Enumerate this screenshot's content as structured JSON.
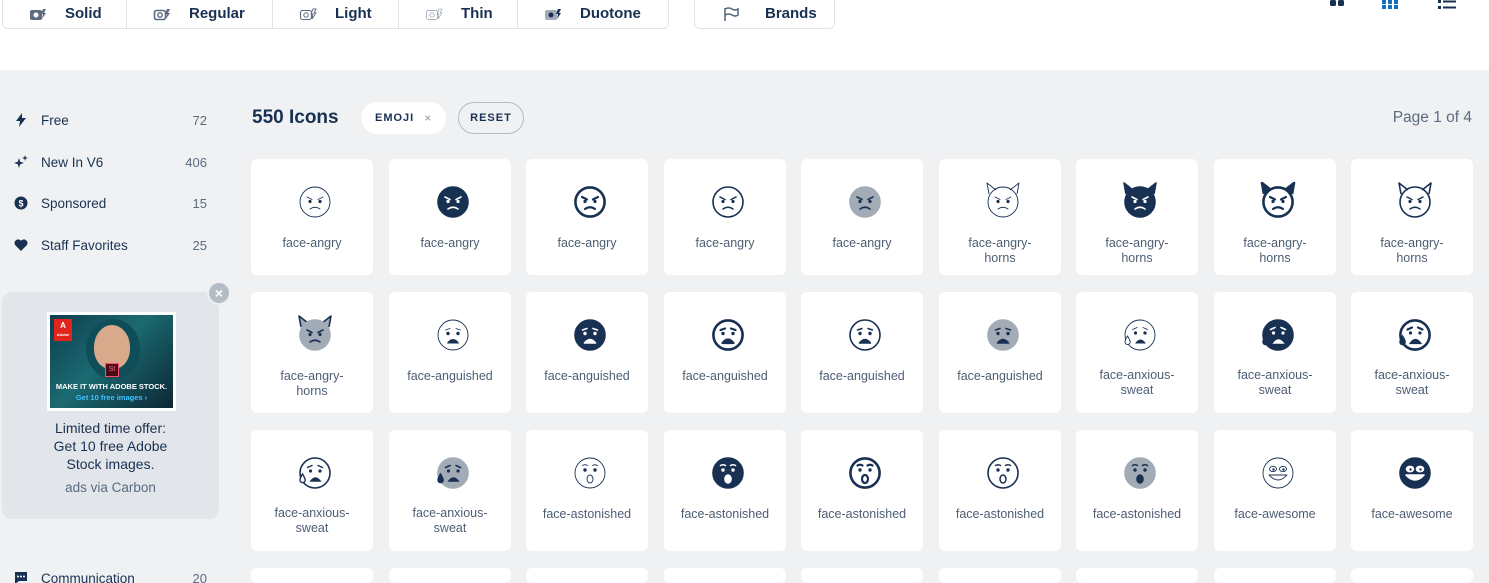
{
  "styles": {
    "tabs": [
      {
        "label": "Solid",
        "icon": "camera-solid-icon"
      },
      {
        "label": "Regular",
        "icon": "camera-regular-icon"
      },
      {
        "label": "Light",
        "icon": "camera-light-icon"
      },
      {
        "label": "Thin",
        "icon": "camera-thin-icon"
      },
      {
        "label": "Duotone",
        "icon": "camera-duotone-icon"
      }
    ],
    "brands": {
      "label": "Brands",
      "icon": "flag-icon"
    }
  },
  "view_toggles": [
    "large-grid-icon",
    "small-grid-icon",
    "list-view-icon"
  ],
  "sidebar": {
    "items": [
      {
        "label": "Free",
        "count": "72",
        "icon": "bolt-icon"
      },
      {
        "label": "New In V6",
        "count": "406",
        "icon": "sparkles-icon"
      },
      {
        "label": "Sponsored",
        "count": "15",
        "icon": "dollar-circle-icon"
      },
      {
        "label": "Staff Favorites",
        "count": "25",
        "icon": "heart-icon"
      }
    ],
    "bottom_item": {
      "label": "Communication",
      "count": "20",
      "icon": "comment-dots-icon"
    }
  },
  "ad": {
    "logo": "Adobe",
    "badge": "St",
    "tagline": "MAKE IT WITH ADOBE STOCK.",
    "cta": "Get 10 free images ›",
    "text": "Limited time offer: Get 10 free Adobe Stock images.",
    "via": "ads via Carbon"
  },
  "results": {
    "title": "550 Icons",
    "filter_chip": "EMOJI",
    "filter_remove": "×",
    "reset": "RESET",
    "pager": "Page 1 of 4"
  },
  "icons": [
    {
      "name": "face-angry",
      "face": "angry",
      "style": "thin"
    },
    {
      "name": "face-angry",
      "face": "angry",
      "style": "solid"
    },
    {
      "name": "face-angry",
      "face": "angry",
      "style": "regular"
    },
    {
      "name": "face-angry",
      "face": "angry",
      "style": "light"
    },
    {
      "name": "face-angry",
      "face": "angry",
      "style": "duotone"
    },
    {
      "name": "face-angry-horns",
      "face": "horns",
      "style": "thin"
    },
    {
      "name": "face-angry-horns",
      "face": "horns",
      "style": "solid"
    },
    {
      "name": "face-angry-horns",
      "face": "horns",
      "style": "regular"
    },
    {
      "name": "face-angry-horns",
      "face": "horns",
      "style": "light"
    },
    {
      "name": "face-angry-horns",
      "face": "horns",
      "style": "duotone"
    },
    {
      "name": "face-anguished",
      "face": "anguished",
      "style": "thin"
    },
    {
      "name": "face-anguished",
      "face": "anguished",
      "style": "solid"
    },
    {
      "name": "face-anguished",
      "face": "anguished",
      "style": "regular"
    },
    {
      "name": "face-anguished",
      "face": "anguished",
      "style": "light"
    },
    {
      "name": "face-anguished",
      "face": "anguished",
      "style": "duotone"
    },
    {
      "name": "face-anxious-sweat",
      "face": "sweat",
      "style": "thin"
    },
    {
      "name": "face-anxious-sweat",
      "face": "sweat",
      "style": "solid"
    },
    {
      "name": "face-anxious-sweat",
      "face": "sweat",
      "style": "regular"
    },
    {
      "name": "face-anxious-sweat",
      "face": "sweat",
      "style": "light"
    },
    {
      "name": "face-anxious-sweat",
      "face": "sweat",
      "style": "duotone"
    },
    {
      "name": "face-astonished",
      "face": "astonished",
      "style": "thin"
    },
    {
      "name": "face-astonished",
      "face": "astonished",
      "style": "solid"
    },
    {
      "name": "face-astonished",
      "face": "astonished",
      "style": "regular"
    },
    {
      "name": "face-astonished",
      "face": "astonished",
      "style": "light"
    },
    {
      "name": "face-astonished",
      "face": "astonished",
      "style": "duotone"
    },
    {
      "name": "face-awesome",
      "face": "awesome",
      "style": "thin"
    },
    {
      "name": "face-awesome",
      "face": "awesome",
      "style": "solid"
    }
  ],
  "colors": {
    "primary": "#183153",
    "duotone": "#a3abb7",
    "accent": "#146ebe",
    "background": "#f0f1f3"
  }
}
